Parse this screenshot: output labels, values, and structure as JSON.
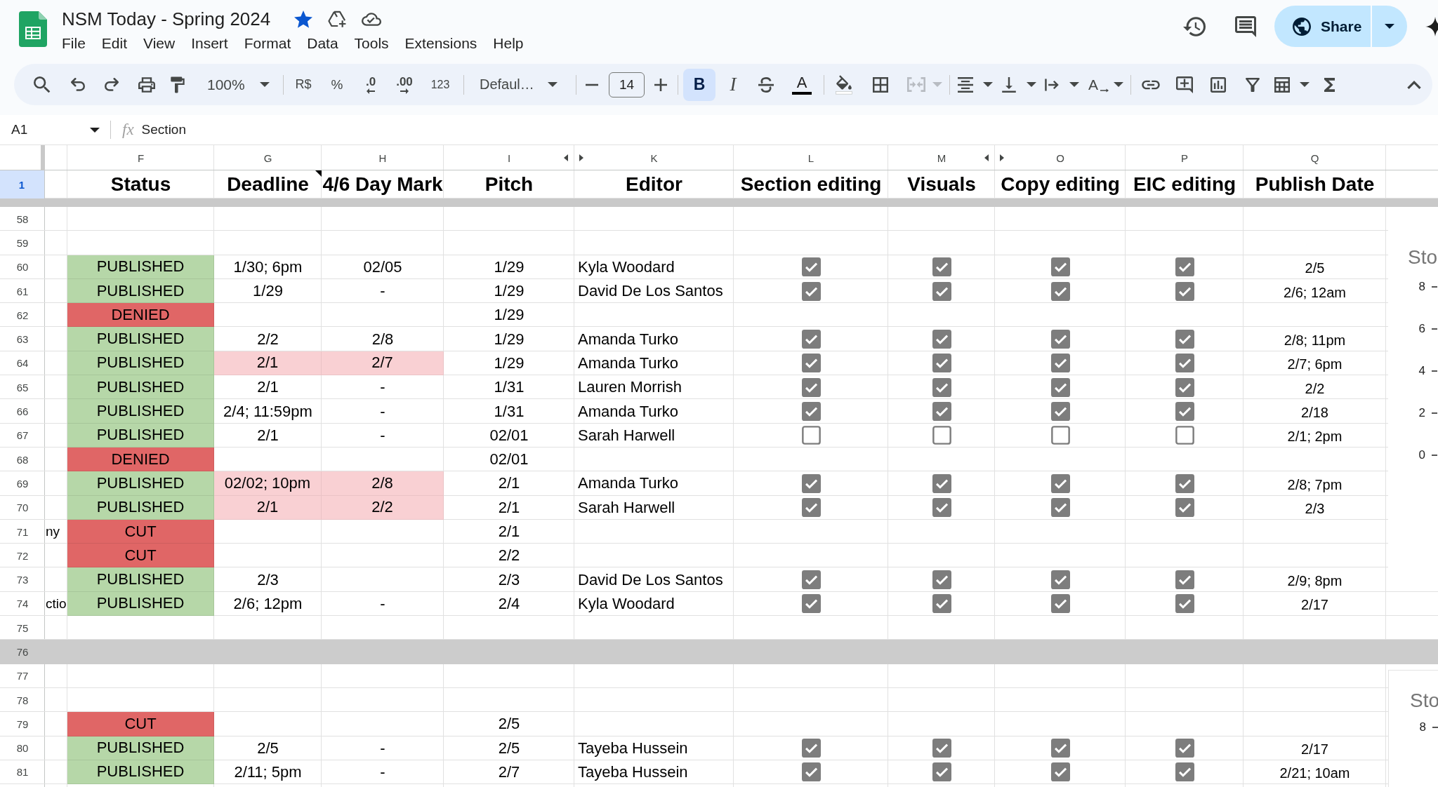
{
  "app": {
    "title": "NSM Today - Spring 2024",
    "starred": true,
    "menu": [
      "File",
      "Edit",
      "View",
      "Insert",
      "Format",
      "Data",
      "Tools",
      "Extensions",
      "Help"
    ],
    "share": "Share"
  },
  "toolbar": {
    "zoom": "100%",
    "currency": "R$",
    "percent": "%",
    "decrease_decimal": ".0",
    "increase_decimal": ".00",
    "number_format": "123",
    "font": "Defaul…",
    "font_size": "14",
    "bold": {
      "label": "B",
      "on": true
    },
    "italic": {
      "label": "I",
      "on": false
    },
    "text_color": "A",
    "merge": {
      "disabled": true
    },
    "rotation": "A"
  },
  "formula_bar": {
    "cell": "A1",
    "symbol": "fx",
    "value": "Section"
  },
  "sheet": {
    "header_row": {
      "number": "1",
      "selected": true
    },
    "columns": [
      {
        "letter": "F",
        "header": "Status",
        "kind": "status",
        "has_note": false,
        "hidden_before": false
      },
      {
        "letter": "G",
        "header": "Deadline",
        "kind": "deadline",
        "has_note": true,
        "hidden_before": false
      },
      {
        "letter": "H",
        "header": "4/6 Day Mark",
        "kind": "day_mark",
        "has_note": false,
        "hidden_before": false
      },
      {
        "letter": "I",
        "header": "Pitch",
        "kind": "pitch",
        "has_note": false,
        "hidden_before": false
      },
      {
        "letter": "K",
        "header": "Editor",
        "kind": "editor",
        "has_note": false,
        "hidden_before": true
      },
      {
        "letter": "L",
        "header": "Section editing",
        "kind": "check",
        "has_note": false,
        "hidden_before": false
      },
      {
        "letter": "M",
        "header": "Visuals",
        "kind": "check",
        "has_note": false,
        "hidden_before": false
      },
      {
        "letter": "O",
        "header": "Copy editing",
        "kind": "check",
        "has_note": false,
        "hidden_before": true
      },
      {
        "letter": "P",
        "header": "EIC editing",
        "kind": "check",
        "has_note": false,
        "hidden_before": false
      },
      {
        "letter": "Q",
        "header": "Publish Date",
        "kind": "publish_date",
        "has_note": false,
        "hidden_before": false
      }
    ],
    "rows": [
      {
        "number": "58",
        "kind": "entry",
        "highlighted": false
      },
      {
        "number": "59",
        "kind": "entry",
        "highlighted": false
      },
      {
        "number": "60",
        "kind": "entry",
        "status": {
          "label": "PUBLISHED",
          "color": "#b6d7a8"
        },
        "deadline": "1/30; 6pm",
        "day_mark": "02/05",
        "pitch": "1/29",
        "editor": "Kyla Woodard",
        "checks": [
          true,
          true,
          true,
          true
        ],
        "publish_date": "2/5",
        "highlighted": false
      },
      {
        "number": "61",
        "kind": "entry",
        "status": {
          "label": "PUBLISHED",
          "color": "#b6d7a8"
        },
        "deadline": "1/29",
        "day_mark": "-",
        "pitch": "1/29",
        "editor": "David De Los Santos",
        "checks": [
          true,
          true,
          true,
          true
        ],
        "publish_date": "2/6; 12am",
        "highlighted": false
      },
      {
        "number": "62",
        "kind": "entry",
        "status": {
          "label": "DENIED",
          "color": "#e06666"
        },
        "pitch": "1/29",
        "highlighted": false
      },
      {
        "number": "63",
        "kind": "entry",
        "status": {
          "label": "PUBLISHED",
          "color": "#b6d7a8"
        },
        "deadline": "2/2",
        "day_mark": "2/8",
        "pitch": "1/29",
        "editor": "Amanda Turko",
        "checks": [
          true,
          true,
          true,
          true
        ],
        "publish_date": "2/8; 11pm",
        "highlighted": false
      },
      {
        "number": "64",
        "kind": "entry",
        "status": {
          "label": "PUBLISHED",
          "color": "#b6d7a8"
        },
        "deadline": "2/1",
        "day_mark": "2/7",
        "pitch": "1/29",
        "editor": "Amanda Turko",
        "checks": [
          true,
          true,
          true,
          true
        ],
        "publish_date": "2/7; 6pm",
        "highlighted": true
      },
      {
        "number": "65",
        "kind": "entry",
        "status": {
          "label": "PUBLISHED",
          "color": "#b6d7a8"
        },
        "deadline": "2/1",
        "day_mark": "-",
        "pitch": "1/31",
        "editor": "Lauren Morrish",
        "checks": [
          true,
          true,
          true,
          true
        ],
        "publish_date": "2/2",
        "highlighted": false
      },
      {
        "number": "66",
        "kind": "entry",
        "status": {
          "label": "PUBLISHED",
          "color": "#b6d7a8"
        },
        "deadline": "2/4; 11:59pm",
        "day_mark": "-",
        "pitch": "1/31",
        "editor": "Amanda Turko",
        "checks": [
          true,
          true,
          true,
          true
        ],
        "publish_date": "2/18",
        "highlighted": false
      },
      {
        "number": "67",
        "kind": "entry",
        "status": {
          "label": "PUBLISHED",
          "color": "#b6d7a8"
        },
        "deadline": "2/1",
        "day_mark": "-",
        "pitch": "02/01",
        "editor": "Sarah Harwell",
        "checks": [
          false,
          false,
          false,
          false
        ],
        "publish_date": "2/1; 2pm",
        "highlighted": false
      },
      {
        "number": "68",
        "kind": "entry",
        "status": {
          "label": "DENIED",
          "color": "#e06666"
        },
        "pitch": "02/01",
        "highlighted": false
      },
      {
        "number": "69",
        "kind": "entry",
        "status": {
          "label": "PUBLISHED",
          "color": "#b6d7a8"
        },
        "deadline": "02/02; 10pm",
        "day_mark": "2/8",
        "pitch": "2/1",
        "editor": "Amanda Turko",
        "checks": [
          true,
          true,
          true,
          true
        ],
        "publish_date": "2/8; 7pm",
        "highlighted": true
      },
      {
        "number": "70",
        "kind": "entry",
        "status": {
          "label": "PUBLISHED",
          "color": "#b6d7a8"
        },
        "deadline": "2/1",
        "day_mark": "2/2",
        "pitch": "2/1",
        "editor": "Sarah Harwell",
        "checks": [
          true,
          true,
          true,
          true
        ],
        "publish_date": "2/3",
        "highlighted": true
      },
      {
        "number": "71",
        "kind": "entry",
        "column_e": "ny",
        "status": {
          "label": "CUT",
          "color": "#e06666"
        },
        "pitch": "2/1",
        "highlighted": false
      },
      {
        "number": "72",
        "kind": "entry",
        "status": {
          "label": "CUT",
          "color": "#e06666"
        },
        "pitch": "2/2",
        "highlighted": false
      },
      {
        "number": "73",
        "kind": "entry",
        "status": {
          "label": "PUBLISHED",
          "color": "#b6d7a8"
        },
        "deadline": "2/3",
        "pitch": "2/3",
        "editor": "David De Los Santos",
        "checks": [
          true,
          true,
          true,
          true
        ],
        "publish_date": "2/9; 8pm",
        "highlighted": false
      },
      {
        "number": "74",
        "kind": "entry",
        "column_e": "ctio",
        "status": {
          "label": "PUBLISHED",
          "color": "#b6d7a8"
        },
        "deadline": "2/6; 12pm",
        "day_mark": "-",
        "pitch": "2/4",
        "editor": "Kyla Woodard",
        "checks": [
          true,
          true,
          true,
          true
        ],
        "publish_date": "2/17",
        "highlighted": false
      },
      {
        "number": "75",
        "kind": "entry",
        "highlighted": false
      },
      {
        "number": "76",
        "kind": "band",
        "highlighted": false
      },
      {
        "number": "77",
        "kind": "entry",
        "highlighted": false
      },
      {
        "number": "78",
        "kind": "entry",
        "highlighted": false
      },
      {
        "number": "79",
        "kind": "entry",
        "status": {
          "label": "CUT",
          "color": "#e06666"
        },
        "pitch": "2/5",
        "highlighted": false
      },
      {
        "number": "80",
        "kind": "entry",
        "status": {
          "label": "PUBLISHED",
          "color": "#b6d7a8"
        },
        "deadline": "2/5",
        "day_mark": "-",
        "pitch": "2/5",
        "editor": "Tayeba Hussein",
        "checks": [
          true,
          true,
          true,
          true
        ],
        "publish_date": "2/17",
        "highlighted": false
      },
      {
        "number": "81",
        "kind": "entry",
        "status": {
          "label": "PUBLISHED",
          "color": "#b6d7a8"
        },
        "deadline": "2/11; 5pm",
        "day_mark": "-",
        "pitch": "2/7",
        "editor": "Tayeba Hussein",
        "checks": [
          true,
          true,
          true,
          true
        ],
        "publish_date": "2/21; 10am",
        "highlighted": false
      }
    ]
  },
  "charts": [
    {
      "title": "Sto",
      "axis_labels": [
        "8",
        "6",
        "4",
        "2",
        "0"
      ]
    },
    {
      "title": "Sto",
      "axis_labels": [
        "8"
      ]
    }
  ]
}
